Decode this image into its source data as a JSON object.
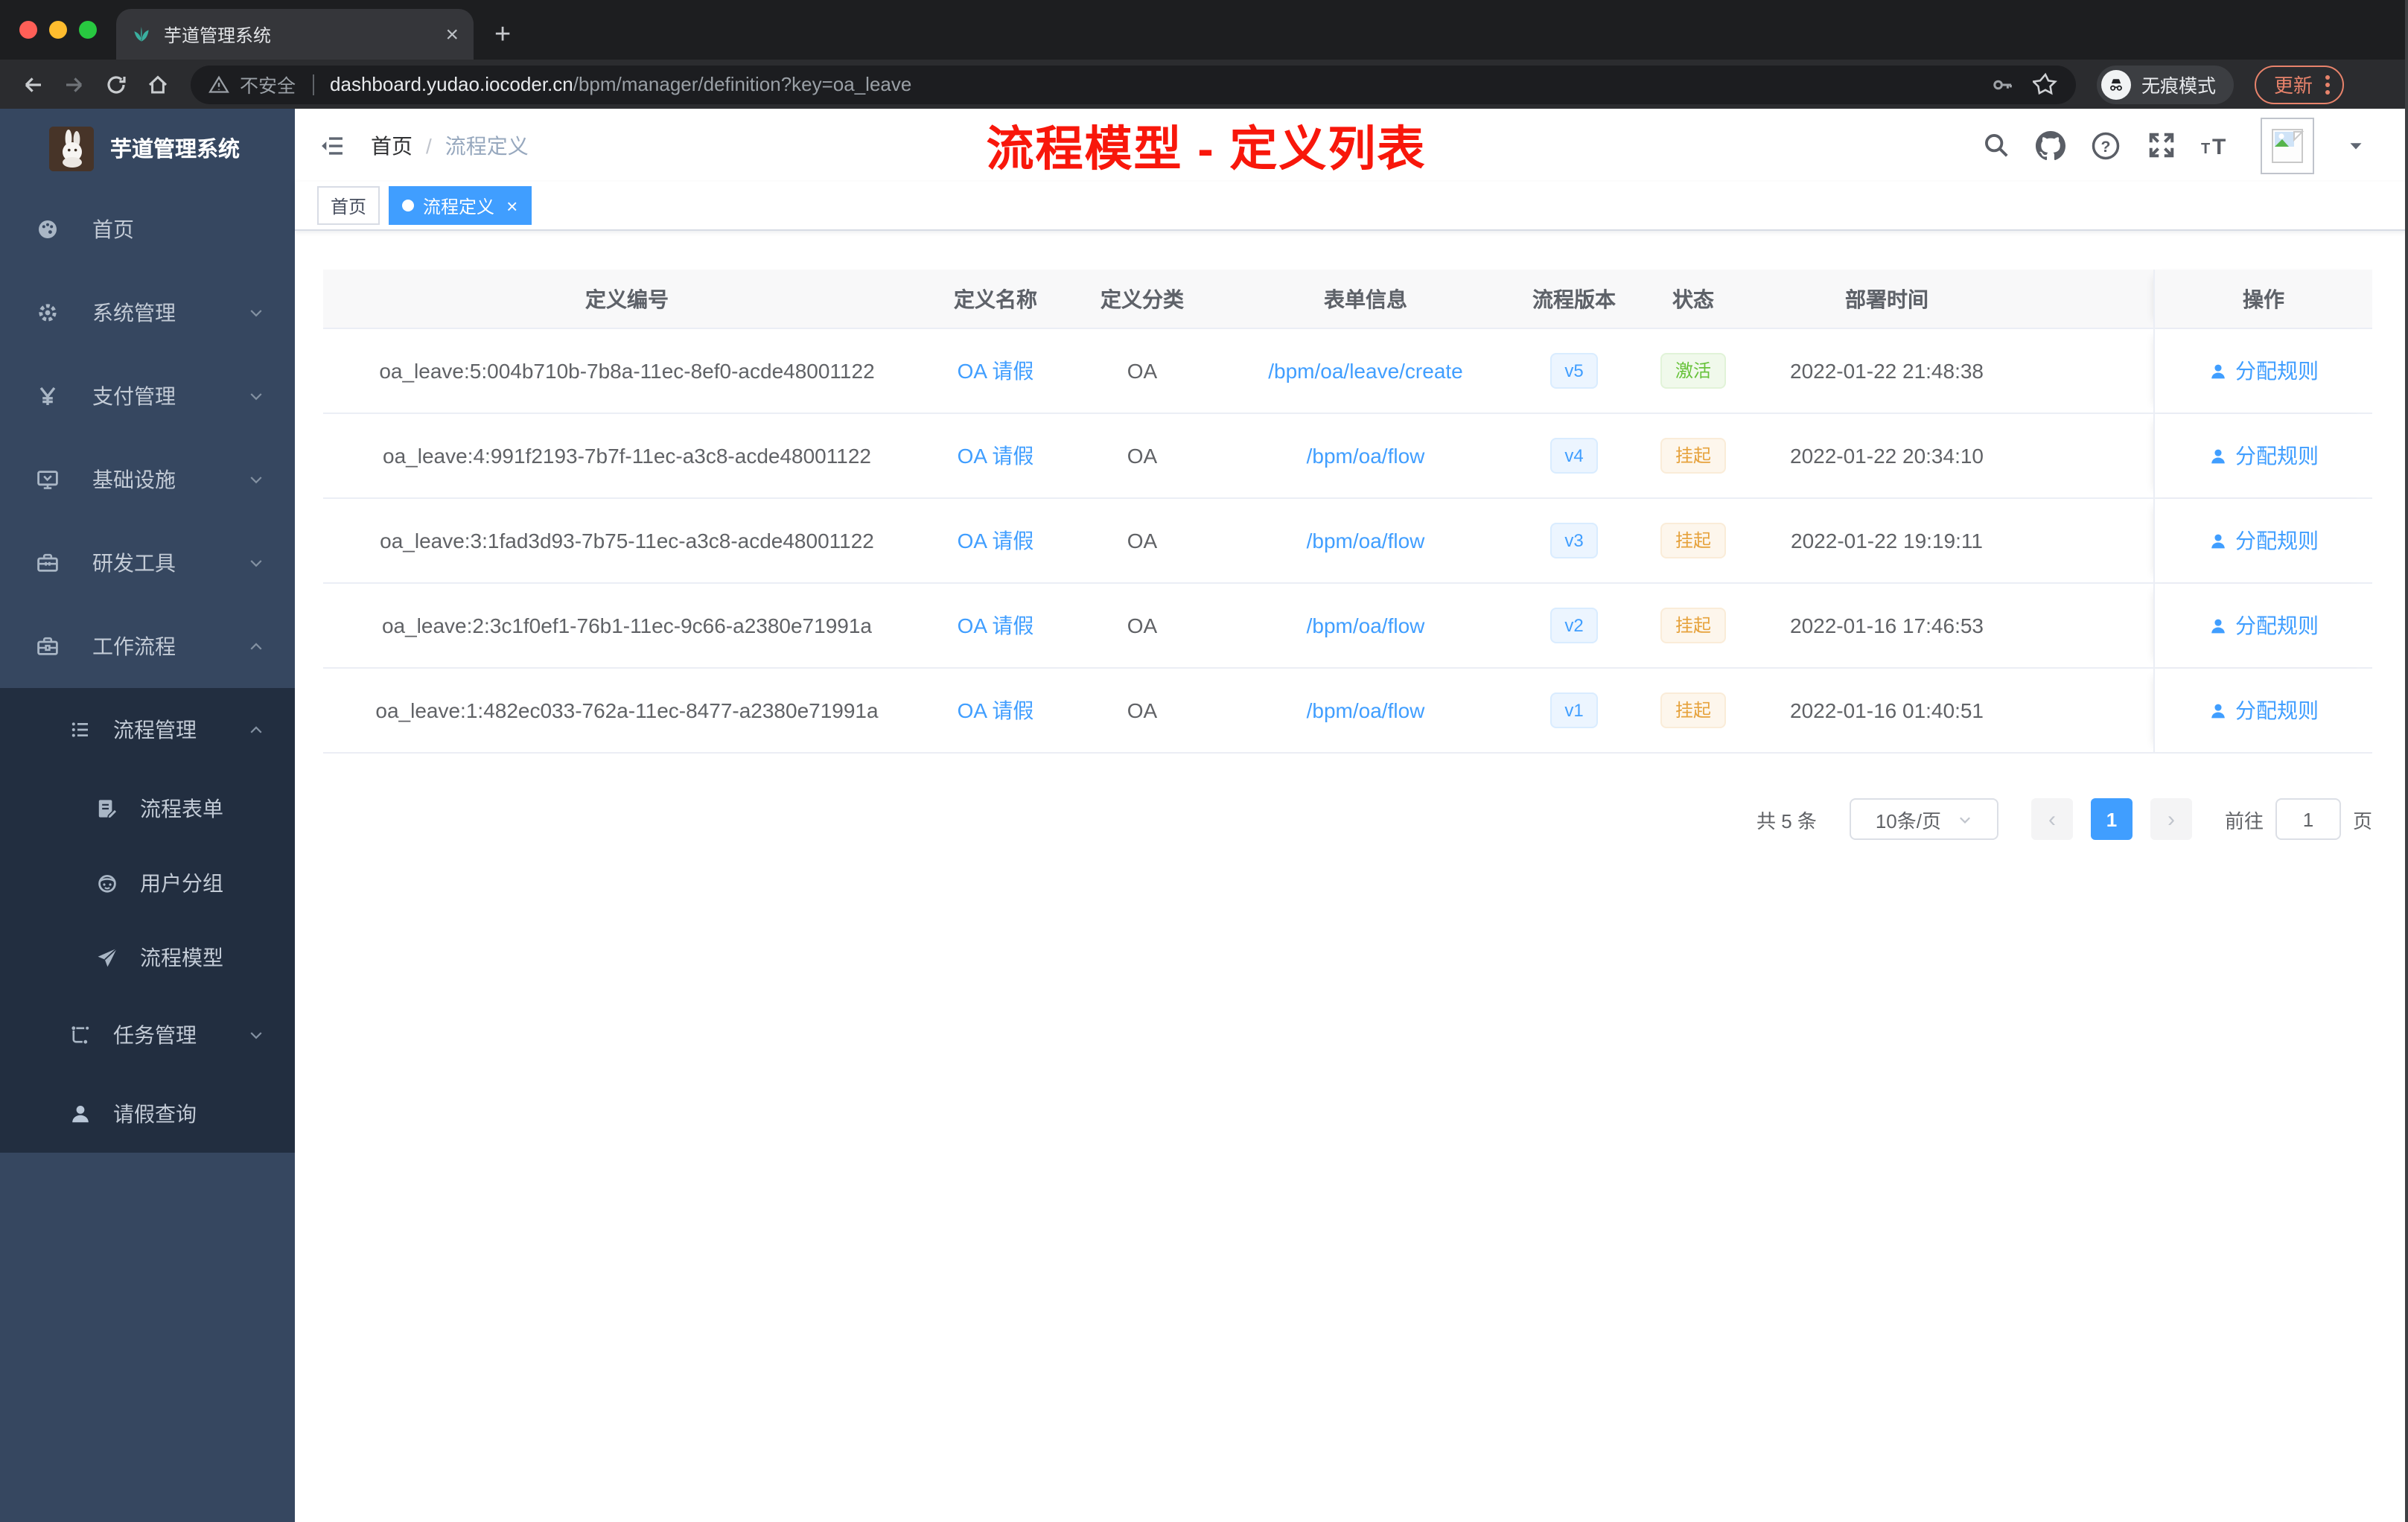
{
  "browser": {
    "tab": {
      "title": "芋道管理系统"
    },
    "security_label": "不安全",
    "url": {
      "host": "dashboard.yudao.iocoder.cn",
      "path": "/bpm/manager/definition?key=oa_leave"
    },
    "incognito_label": "无痕模式",
    "update_label": "更新"
  },
  "icons": {
    "close": "×",
    "plus": "+",
    "prev": "‹",
    "next": "›",
    "font_size": "tT",
    "yen": "¥"
  },
  "sidebar": {
    "title": "芋道管理系统",
    "items": [
      {
        "label": "首页"
      },
      {
        "label": "系统管理"
      },
      {
        "label": "支付管理"
      },
      {
        "label": "基础设施"
      },
      {
        "label": "研发工具"
      },
      {
        "label": "工作流程"
      },
      {
        "label": "流程管理"
      },
      {
        "label": "流程表单"
      },
      {
        "label": "用户分组"
      },
      {
        "label": "流程模型"
      },
      {
        "label": "任务管理"
      },
      {
        "label": "请假查询"
      }
    ]
  },
  "header": {
    "breadcrumb": [
      "首页",
      "流程定义"
    ],
    "breadcrumb_separator": "/",
    "annotation": "流程模型 - 定义列表",
    "annotation_color": "#f8170b"
  },
  "tags": {
    "home": "首页",
    "active": "流程定义"
  },
  "table": {
    "columns": [
      "定义编号",
      "定义名称",
      "定义分类",
      "表单信息",
      "流程版本",
      "状态",
      "部署时间",
      "操作"
    ],
    "rows": [
      {
        "id": "oa_leave:5:004b710b-7b8a-11ec-8ef0-acde48001122",
        "name": "OA 请假",
        "category": "OA",
        "form": "/bpm/oa/leave/create",
        "version": "v5",
        "status": "激活",
        "status_type": "success",
        "time": "2022-01-22 21:48:38",
        "action": "分配规则"
      },
      {
        "id": "oa_leave:4:991f2193-7b7f-11ec-a3c8-acde48001122",
        "name": "OA 请假",
        "category": "OA",
        "form": "/bpm/oa/flow",
        "version": "v4",
        "status": "挂起",
        "status_type": "warning",
        "time": "2022-01-22 20:34:10",
        "action": "分配规则"
      },
      {
        "id": "oa_leave:3:1fad3d93-7b75-11ec-a3c8-acde48001122",
        "name": "OA 请假",
        "category": "OA",
        "form": "/bpm/oa/flow",
        "version": "v3",
        "status": "挂起",
        "status_type": "warning",
        "time": "2022-01-22 19:19:11",
        "action": "分配规则"
      },
      {
        "id": "oa_leave:2:3c1f0ef1-76b1-11ec-9c66-a2380e71991a",
        "name": "OA 请假",
        "category": "OA",
        "form": "/bpm/oa/flow",
        "version": "v2",
        "status": "挂起",
        "status_type": "warning",
        "time": "2022-01-16 17:46:53",
        "action": "分配规则"
      },
      {
        "id": "oa_leave:1:482ec033-762a-11ec-8477-a2380e71991a",
        "name": "OA 请假",
        "category": "OA",
        "form": "/bpm/oa/flow",
        "version": "v1",
        "status": "挂起",
        "status_type": "warning",
        "time": "2022-01-16 01:40:51",
        "action": "分配规则"
      }
    ]
  },
  "pagination": {
    "total": "共 5 条",
    "page_size": "10条/页",
    "current": "1",
    "goto_label": "前往",
    "goto_value": "1",
    "page_unit": "页"
  },
  "colors": {
    "accent": "#409eff",
    "success": "#67c23a",
    "warning": "#e6a23c",
    "sidebar_bg": "#364760",
    "submenu_bg": "#222e40"
  }
}
